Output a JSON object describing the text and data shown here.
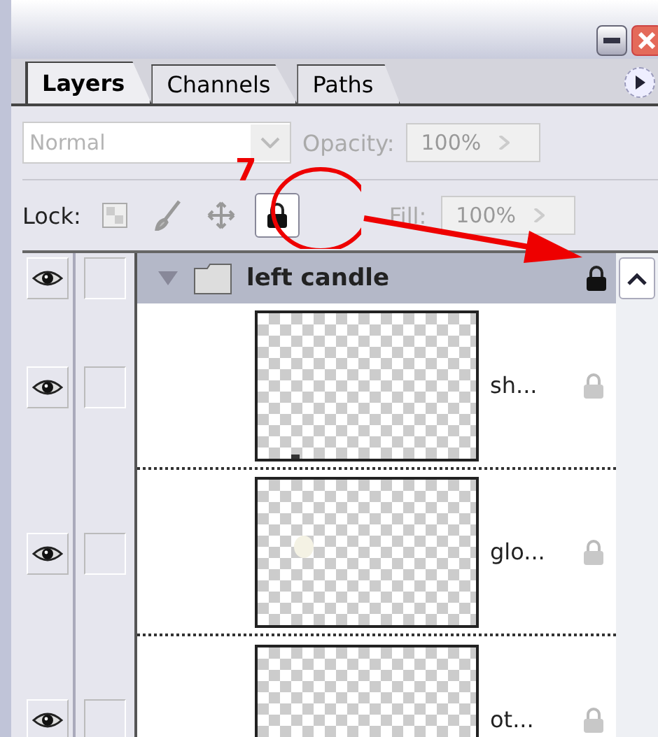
{
  "panel": {
    "tabs": [
      {
        "label": "Layers",
        "selected": true
      },
      {
        "label": "Channels",
        "selected": false
      },
      {
        "label": "Paths",
        "selected": false
      }
    ],
    "blend_mode": {
      "value": "Normal",
      "disabled": true
    },
    "opacity": {
      "label": "Opacity:",
      "value": "100%",
      "disabled": true
    },
    "lock": {
      "label": "Lock:",
      "buttons": [
        {
          "kind": "transparency",
          "selected": false
        },
        {
          "kind": "paint",
          "selected": false
        },
        {
          "kind": "move",
          "selected": false
        },
        {
          "kind": "all",
          "selected": true
        }
      ]
    },
    "fill": {
      "label": "Fill:",
      "value": "100%",
      "disabled": true
    },
    "layers": [
      {
        "kind": "group",
        "name": "left candle",
        "expanded": true,
        "visible": true,
        "locked": true,
        "children": [
          {
            "kind": "layer",
            "name": "sh...",
            "visible": true,
            "lock_inherited": true
          },
          {
            "kind": "layer",
            "name": "glo...",
            "visible": true,
            "lock_inherited": true
          },
          {
            "kind": "layer",
            "name": "ot...",
            "visible": true,
            "lock_inherited": true
          }
        ]
      }
    ]
  },
  "annotation": {
    "step": "7"
  }
}
